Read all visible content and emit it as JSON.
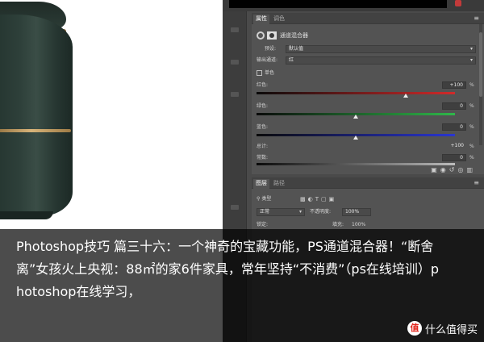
{
  "ps_panel": {
    "tabs": [
      "属性",
      "调色"
    ],
    "panel_menu_icon": "menu-icon",
    "adjustment_title": "通道混合器",
    "preset_label": "预设:",
    "preset_value": "默认值",
    "output_channel_label": "输出通道:",
    "output_channel_value": "红",
    "monochrome_label": "单色",
    "sliders": [
      {
        "label": "红色:",
        "value": "+100",
        "unit": "%",
        "color": "#d22a2a",
        "level": 0.75
      },
      {
        "label": "绿色:",
        "value": "0",
        "unit": "%",
        "color": "#2fb84a",
        "level": 0.5
      },
      {
        "label": "蓝色:",
        "value": "0",
        "unit": "%",
        "color": "#2a36d2",
        "level": 0.5
      }
    ],
    "total_label": "总计:",
    "total_value": "+100",
    "total_unit": "%",
    "constant_label": "常数:",
    "constant_value": "0",
    "constant_unit": "%"
  },
  "layers_panel": {
    "tabs": [
      "图层",
      "路径"
    ],
    "filter_label": "类型",
    "blend_mode": "正常",
    "opacity_label": "不透明度:",
    "opacity_value": "100%",
    "lock_label": "锁定:",
    "fill_label": "填充:",
    "fill_value": "100%"
  },
  "caption": {
    "text": "Photoshop技巧 篇三十六：一个神奇的宝藏功能，PS通道混合器！“断舍离”女孩火上央视：88㎡的家6件家具，常年坚持“不消费”（ps在线培训）photoshop在线学习，"
  },
  "watermark": {
    "logo": "值",
    "text": "什么值得买"
  },
  "colors": {
    "caption_bg": "#000000",
    "panel_bg": "#535353",
    "fryer_green": "#2e403a",
    "accent_gold": "#d8b47a"
  }
}
